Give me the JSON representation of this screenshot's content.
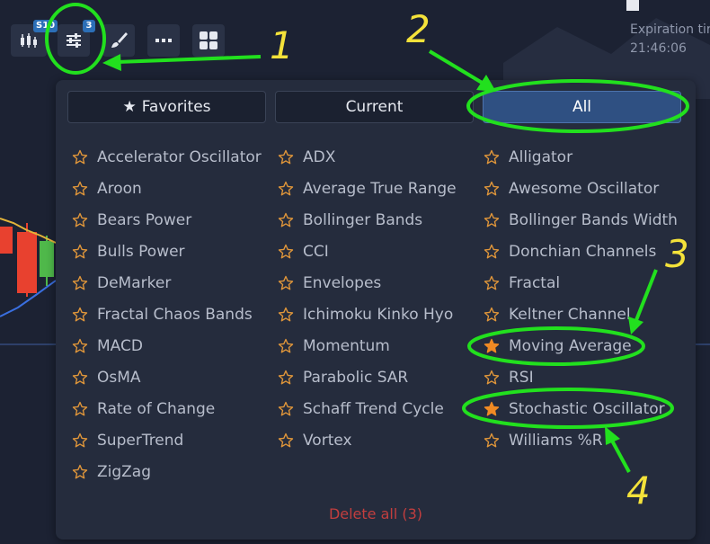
{
  "toolbar": {
    "timeframe_badge": "S10",
    "indicators_badge": "3",
    "icons": [
      "chart-type-icon",
      "indicators-icon",
      "drawing-brush-icon",
      "more-icon",
      "layout-grid-icon"
    ]
  },
  "expiration": {
    "label": "Expiration tir",
    "time": "21:46:06"
  },
  "tabs": [
    {
      "label": "Favorites",
      "icon": "star-icon",
      "active": false
    },
    {
      "label": "Current",
      "active": false
    },
    {
      "label": "All",
      "active": true
    }
  ],
  "indicators": {
    "col1": [
      {
        "label": "Accelerator Oscillator",
        "starred": false
      },
      {
        "label": "Aroon",
        "starred": false
      },
      {
        "label": "Bears Power",
        "starred": false
      },
      {
        "label": "Bulls Power",
        "starred": false
      },
      {
        "label": "DeMarker",
        "starred": false
      },
      {
        "label": "Fractal Chaos Bands",
        "starred": false
      },
      {
        "label": "MACD",
        "starred": false
      },
      {
        "label": "OsMA",
        "starred": false
      },
      {
        "label": "Rate of Change",
        "starred": false
      },
      {
        "label": "SuperTrend",
        "starred": false
      },
      {
        "label": "ZigZag",
        "starred": false
      }
    ],
    "col2": [
      {
        "label": "ADX",
        "starred": false
      },
      {
        "label": "Average True Range",
        "starred": false
      },
      {
        "label": "Bollinger Bands",
        "starred": false
      },
      {
        "label": "CCI",
        "starred": false
      },
      {
        "label": "Envelopes",
        "starred": false
      },
      {
        "label": "Ichimoku Kinko Hyo",
        "starred": false
      },
      {
        "label": "Momentum",
        "starred": false
      },
      {
        "label": "Parabolic SAR",
        "starred": false
      },
      {
        "label": "Schaff Trend Cycle",
        "starred": false
      },
      {
        "label": "Vortex",
        "starred": false
      }
    ],
    "col3": [
      {
        "label": "Alligator",
        "starred": false
      },
      {
        "label": "Awesome Oscillator",
        "starred": false
      },
      {
        "label": "Bollinger Bands Width",
        "starred": false
      },
      {
        "label": "Donchian Channels",
        "starred": false
      },
      {
        "label": "Fractal",
        "starred": false
      },
      {
        "label": "Keltner Channel",
        "starred": false
      },
      {
        "label": "Moving Average",
        "starred": true
      },
      {
        "label": "RSI",
        "starred": false
      },
      {
        "label": "Stochastic Oscillator",
        "starred": true
      },
      {
        "label": "Williams %R",
        "starred": false
      }
    ]
  },
  "delete_all": "Delete all (3)",
  "annotations": {
    "numbers": [
      "1",
      "2",
      "3",
      "4"
    ],
    "highlight_color": "#22e01e",
    "number_color": "#f4e23a"
  },
  "colors": {
    "background": "#1c2233",
    "panel": "#252c3d",
    "star_outline": "#e0963a",
    "star_filled": "#f08a24",
    "delete_text": "#c23e3e",
    "active_tab": "#2f5082",
    "candle_red": "#e8412f",
    "candle_green": "#4fb84a",
    "ma_yellow": "#e3b43a",
    "ma_blue": "#3a6fe0"
  }
}
